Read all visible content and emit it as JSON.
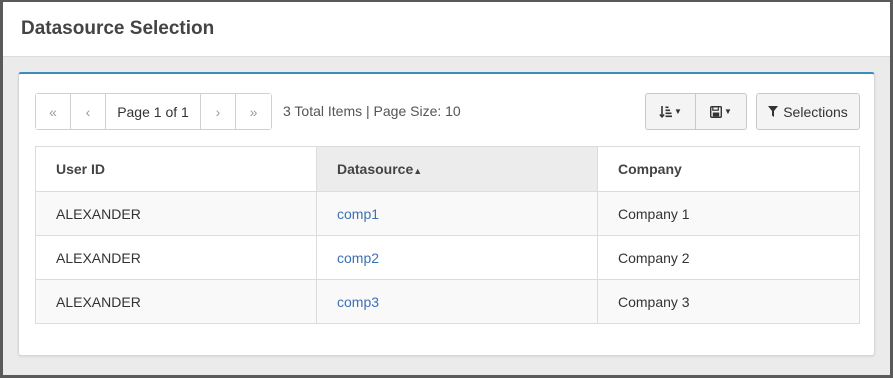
{
  "header": {
    "title": "Datasource Selection"
  },
  "pager": {
    "first": "«",
    "prev": "‹",
    "page": "Page 1 of 1",
    "next": "›",
    "last": "»"
  },
  "summary": "3 Total Items | Page Size: 10",
  "toolbar": {
    "sort_icon": "sort-amount-icon",
    "save_icon": "floppy-disk-icon",
    "selections_label": "Selections"
  },
  "table": {
    "columns": [
      "User ID",
      "Datasource",
      "Company"
    ],
    "sort_indicator": "▲",
    "rows": [
      [
        "ALEXANDER",
        "comp1",
        "Company 1"
      ],
      [
        "ALEXANDER",
        "comp2",
        "Company 2"
      ],
      [
        "ALEXANDER",
        "comp3",
        "Company 3"
      ]
    ]
  },
  "colors": {
    "accent": "#3c8dbc",
    "link": "#3c70b5"
  }
}
